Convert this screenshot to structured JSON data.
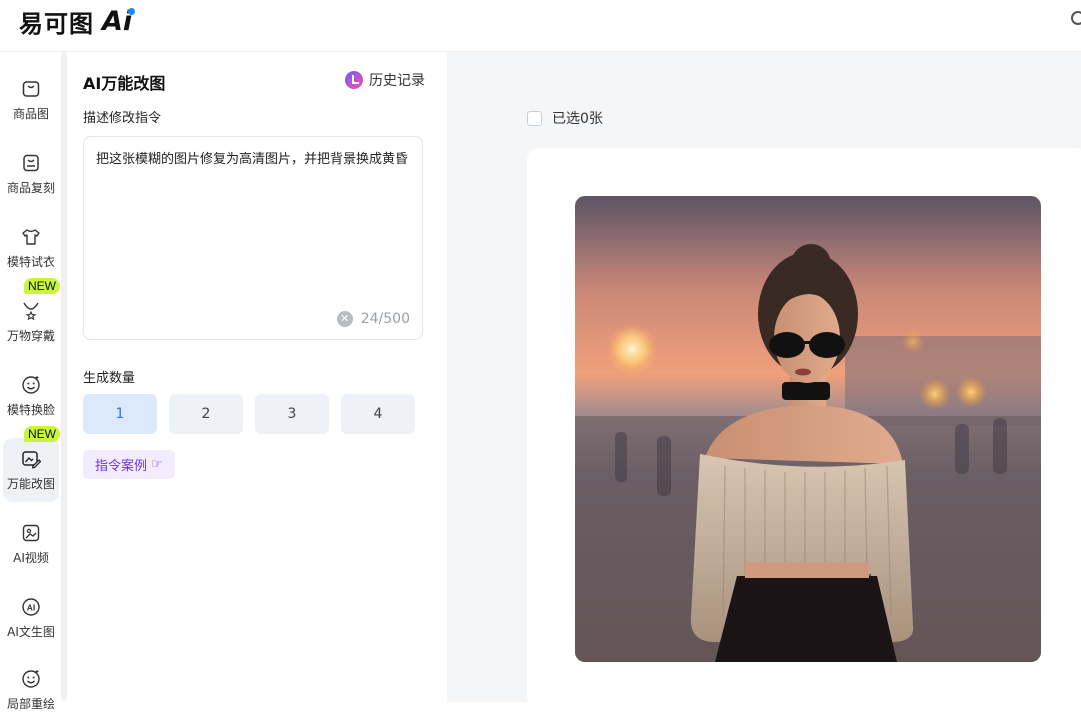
{
  "header": {
    "logo_text": "易可图",
    "logo_ai": "Ai"
  },
  "sidebar": {
    "items": [
      {
        "label": "商品图",
        "icon": "bag-icon"
      },
      {
        "label": "商品复刻",
        "icon": "bag-copy-icon"
      },
      {
        "label": "模特试衣",
        "icon": "tshirt-icon"
      },
      {
        "label": "万物穿戴",
        "icon": "necklace-icon",
        "badge": "NEW"
      },
      {
        "label": "模特换脸",
        "icon": "face-swap-icon"
      },
      {
        "label": "万能改图",
        "icon": "image-edit-icon",
        "badge": "NEW",
        "active": true
      },
      {
        "label": "AI视频",
        "icon": "video-icon"
      },
      {
        "label": "AI文生图",
        "icon": "ai-text-image-icon"
      },
      {
        "label": "局部重绘",
        "icon": "face-icon"
      }
    ]
  },
  "panel": {
    "title": "AI万能改图",
    "history_label": "历史记录",
    "prompt_label": "描述修改指令",
    "prompt_value": "把这张模糊的图片修复为高清图片，并把背景换成黄昏",
    "prompt_count": "24/500",
    "quantity_label": "生成数量",
    "quantity_options": [
      "1",
      "2",
      "3",
      "4"
    ],
    "quantity_selected": "1",
    "cases_label": "指令案例"
  },
  "main": {
    "selected_label": "已选0张"
  }
}
